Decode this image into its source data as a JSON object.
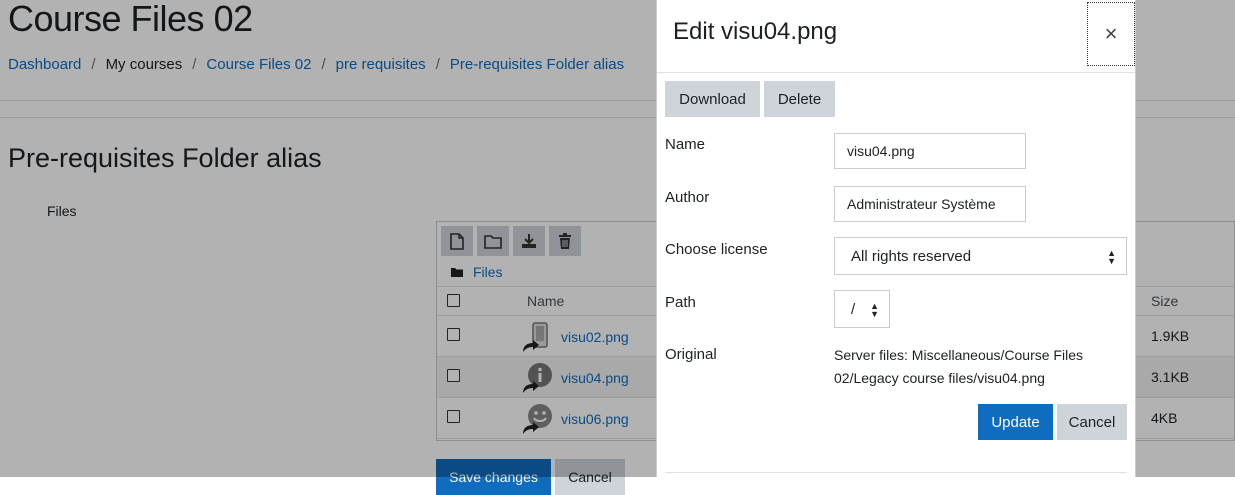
{
  "page": {
    "title": "Course Files 02",
    "breadcrumb": [
      "Dashboard",
      "My courses",
      "Course Files 02",
      "pre requisites",
      "Pre-requisites Folder alias"
    ],
    "section_heading": "Pre-requisites Folder alias",
    "files_label": "Files"
  },
  "filemanager": {
    "path": "Files",
    "col_name": "Name",
    "col_size": "Size",
    "rows": [
      {
        "name": "visu02.png",
        "size": "1.9KB"
      },
      {
        "name": "visu04.png",
        "size": "3.1KB"
      },
      {
        "name": "visu06.png",
        "size": "4KB"
      }
    ],
    "save_label": "Save changes",
    "cancel_label": "Cancel"
  },
  "dialog": {
    "title": "Edit visu04.png",
    "close_glyph": "×",
    "download_label": "Download",
    "delete_label": "Delete",
    "name_label": "Name",
    "name_value": "visu04.png",
    "author_label": "Author",
    "author_value": "Administrateur Système",
    "license_label": "Choose license",
    "license_value": "All rights reserved",
    "path_label": "Path",
    "path_value": "/",
    "original_label": "Original",
    "original_value": "Server files: Miscellaneous/Course Files 02/Legacy course files/visu04.png",
    "update_label": "Update",
    "cancel_label": "Cancel"
  },
  "colors": {
    "link": "#0f6cbf",
    "primary": "#0f6cbf",
    "secondary": "#ced4da"
  }
}
